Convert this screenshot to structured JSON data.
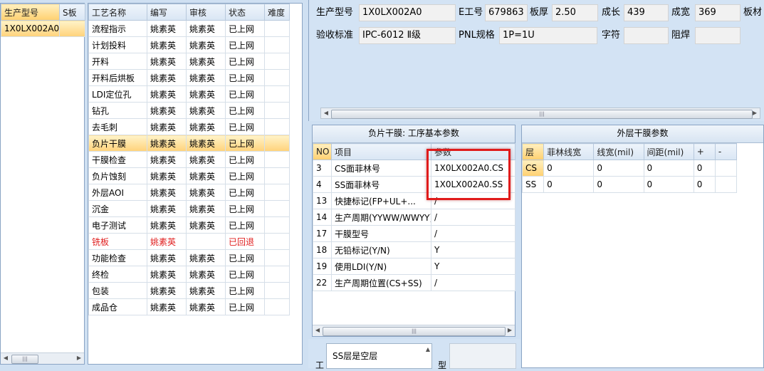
{
  "model_list": {
    "headers": [
      "生产型号",
      "S板"
    ],
    "rows": [
      [
        "1X0LX002A0",
        ""
      ]
    ]
  },
  "process_list": {
    "headers": [
      "工艺名称",
      "编写",
      "审核",
      "状态",
      "难度"
    ],
    "rows": [
      [
        "流程指示",
        "姚素英",
        "姚素英",
        "已上网",
        ""
      ],
      [
        "计划投料",
        "姚素英",
        "姚素英",
        "已上网",
        ""
      ],
      [
        "开料",
        "姚素英",
        "姚素英",
        "已上网",
        ""
      ],
      [
        "开料后烘板",
        "姚素英",
        "姚素英",
        "已上网",
        ""
      ],
      [
        "LDI定位孔",
        "姚素英",
        "姚素英",
        "已上网",
        ""
      ],
      [
        "钻孔",
        "姚素英",
        "姚素英",
        "已上网",
        ""
      ],
      [
        "去毛刺",
        "姚素英",
        "姚素英",
        "已上网",
        ""
      ],
      [
        "负片干膜",
        "姚素英",
        "姚素英",
        "已上网",
        ""
      ],
      [
        "干膜检查",
        "姚素英",
        "姚素英",
        "已上网",
        ""
      ],
      [
        "负片蚀刻",
        "姚素英",
        "姚素英",
        "已上网",
        ""
      ],
      [
        "外层AOI",
        "姚素英",
        "姚素英",
        "已上网",
        ""
      ],
      [
        "沉金",
        "姚素英",
        "姚素英",
        "已上网",
        ""
      ],
      [
        "电子测试",
        "姚素英",
        "姚素英",
        "已上网",
        ""
      ],
      [
        "铣板",
        "姚素英",
        "",
        "已回退",
        ""
      ],
      [
        "功能检查",
        "姚素英",
        "姚素英",
        "已上网",
        ""
      ],
      [
        "终检",
        "姚素英",
        "姚素英",
        "已上网",
        ""
      ],
      [
        "包装",
        "姚素英",
        "姚素英",
        "已上网",
        ""
      ],
      [
        "成品仓",
        "姚素英",
        "姚素英",
        "已上网",
        ""
      ]
    ],
    "selected_index": 7,
    "returned_index": 13
  },
  "info": {
    "model_label": "生产型号",
    "model_value": "1X0LX002A0",
    "eno_label": "E工号",
    "eno_value": "679863",
    "thickness_label": "板厚",
    "thickness_value": "2.50",
    "length_label": "成长",
    "length_value": "439",
    "width_label": "成宽",
    "width_value": "369",
    "material_label": "板材",
    "standard_label": "验收标准",
    "standard_value": "IPC-6012 Ⅱ级",
    "pnl_label": "PNL规格",
    "pnl_value": "1P=1U",
    "char_label": "字符",
    "char_value": "",
    "mask_label": "阻焊",
    "mask_value": ""
  },
  "params_panel": {
    "title": "负片干膜: 工序基本参数",
    "headers": [
      "NO",
      "项目",
      "参数"
    ],
    "rows": [
      [
        "3",
        "CS面菲林号",
        "1X0LX002A0.CS"
      ],
      [
        "4",
        "SS面菲林号",
        "1X0LX002A0.SS"
      ],
      [
        "13",
        "快捷标记(FP+UL+...",
        "/"
      ],
      [
        "14",
        "生产周期(YYWW/WWYY)",
        "/"
      ],
      [
        "17",
        "干膜型号",
        "/"
      ],
      [
        "18",
        "无铅标记(Y/N)",
        "Y"
      ],
      [
        "19",
        "使用LDI(Y/N)",
        "Y"
      ],
      [
        "22",
        "生产周期位置(CS+SS)",
        "/"
      ]
    ]
  },
  "outer_panel": {
    "title": "外层干膜参数",
    "headers": [
      "层",
      "菲林线宽",
      "线宽(mil)",
      "间距(mil)",
      "+",
      "-"
    ],
    "rows": [
      [
        "CS",
        "0",
        "0",
        "0",
        "0",
        ""
      ],
      [
        "SS",
        "0",
        "0",
        "0",
        "0",
        ""
      ]
    ]
  },
  "bottom": {
    "note": "SS层是空层",
    "left_char": "工",
    "right_char": "型"
  },
  "colors": {
    "highlight": "#e01b1b",
    "selected_row": "#ffd27a",
    "returned_text": "#e02020"
  }
}
